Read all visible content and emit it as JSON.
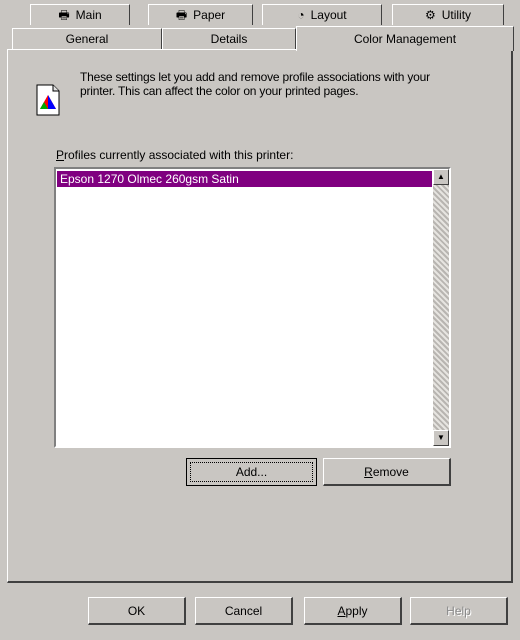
{
  "tabs_back": [
    {
      "icon": "printer-icon",
      "label": "Main"
    },
    {
      "icon": "printer-icon",
      "label": "Paper"
    },
    {
      "icon": "layout-icon",
      "label": "Layout"
    },
    {
      "icon": "utility-icon",
      "label": "Utility"
    }
  ],
  "tabs_front": [
    {
      "label": "General"
    },
    {
      "label": "Details"
    },
    {
      "label": "Color Management",
      "selected": true
    }
  ],
  "description": "These settings let you add and remove profile associations with your printer. This can affect the color on your printed pages.",
  "profiles": {
    "label_underlined": "P",
    "label_rest": "rofiles currently associated with this printer:",
    "items": [
      "Epson 1270 Olmec 260gsm Satin"
    ],
    "selected_color": "#800080"
  },
  "buttons": {
    "add": "Add...",
    "remove_underlined": "R",
    "remove_rest": "emove"
  },
  "footer": {
    "ok": "OK",
    "cancel": "Cancel",
    "apply_underlined": "A",
    "apply_rest": "pply",
    "help": "Help"
  },
  "colors": {
    "face": "#c9c6c2",
    "highlight": "#800080"
  }
}
